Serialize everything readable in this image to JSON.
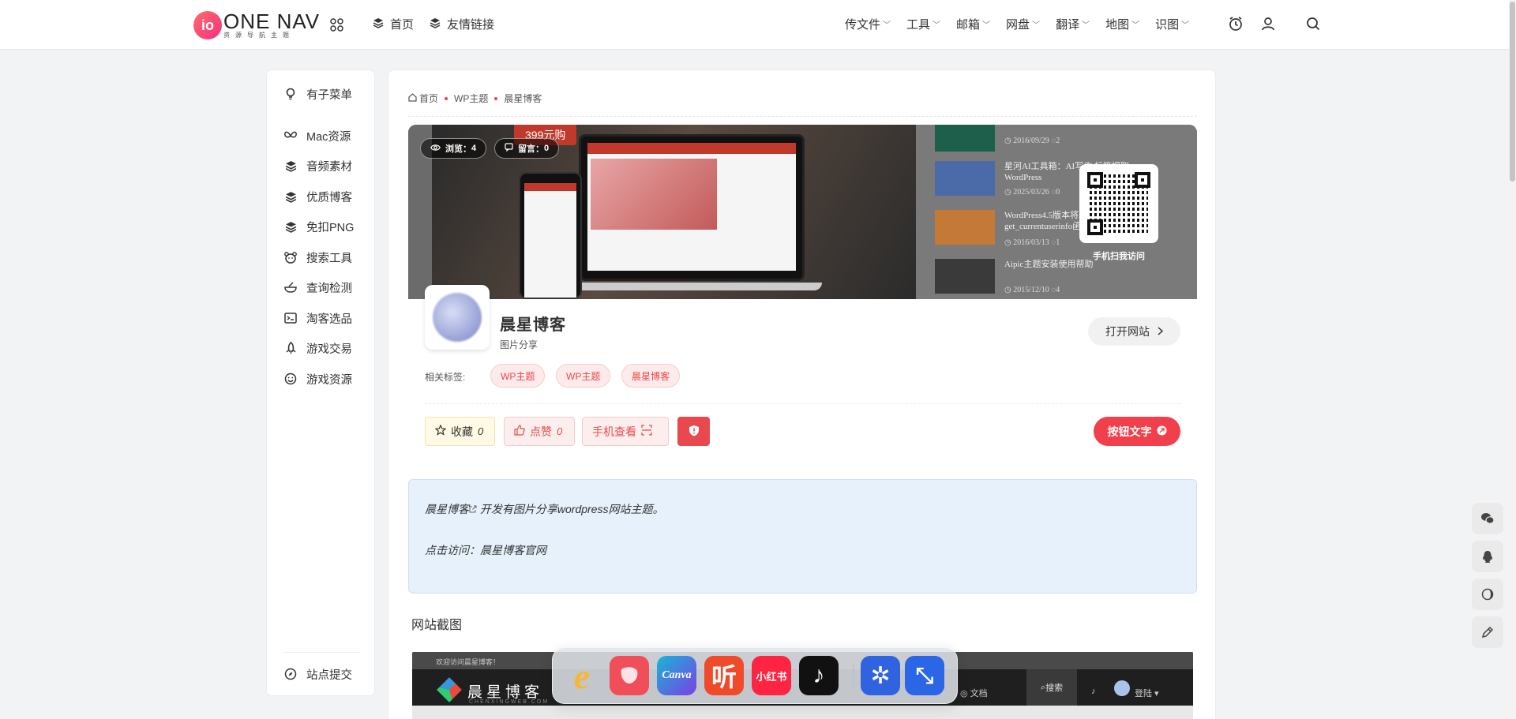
{
  "header": {
    "logo_mark": "io",
    "logo_name": "ONE NAV",
    "logo_tagline": "资源导航主题",
    "nav_left": [
      {
        "label": "首页",
        "icon": "layers-icon"
      },
      {
        "label": "友情链接",
        "icon": "layers-icon"
      }
    ],
    "nav_right": [
      {
        "label": "传文件"
      },
      {
        "label": "工具"
      },
      {
        "label": "邮箱"
      },
      {
        "label": "网盘"
      },
      {
        "label": "翻译"
      },
      {
        "label": "地图"
      },
      {
        "label": "识图"
      }
    ]
  },
  "sidebar": {
    "items": [
      {
        "label": "有子菜单",
        "icon": "bulb-icon"
      },
      {
        "label": "Mac资源",
        "icon": "butterfly-icon"
      },
      {
        "label": "音频素材",
        "icon": "layers-icon"
      },
      {
        "label": "优质博客",
        "icon": "layers-icon"
      },
      {
        "label": "免扣PNG",
        "icon": "layers-icon"
      },
      {
        "label": "搜索工具",
        "icon": "bear-icon"
      },
      {
        "label": "查询检测",
        "icon": "bowl-icon"
      },
      {
        "label": "淘客选品",
        "icon": "terminal-icon"
      },
      {
        "label": "游戏交易",
        "icon": "rocket-icon"
      },
      {
        "label": "游戏资源",
        "icon": "smile-icon"
      }
    ],
    "submit": {
      "label": "站点提交",
      "icon": "compass-icon"
    }
  },
  "breadcrumb": [
    "首页",
    "WP主题",
    "晨星博客"
  ],
  "banner": {
    "price": "399元购",
    "views_label": "浏览：",
    "views": "4",
    "comments_label": "留言：",
    "comments": "0",
    "qr_label": "手机扫我访问",
    "posts": [
      {
        "title": "",
        "date": "2016/09/29",
        "count": "2"
      },
      {
        "title": "星河AI工具箱：AI写作 标签提取，WordPress",
        "date": "2025/03/26",
        "count": "0"
      },
      {
        "title": "WordPress4.5版本将取 get_currentuserinfo函数",
        "date": "2016/03/13",
        "count": "1"
      },
      {
        "title": "Aipic主题安装使用帮助",
        "date": "2015/12/10",
        "count": "4"
      }
    ]
  },
  "site": {
    "title": "晨星博客",
    "subtitle": "图片分享",
    "open_label": "打开网站",
    "tags_label": "相关标签:",
    "tags": [
      "WP主题",
      "WP主题",
      "晨星博客"
    ]
  },
  "actions": {
    "collect_label": "收藏",
    "collect_count": "0",
    "like_label": "点赞",
    "like_count": "0",
    "mobile_label": "手机查看",
    "cta_label": "按钮文字"
  },
  "info": {
    "site_name": "晨星博客",
    "line1_rest": " 开发有图片分享wordpress网站主题。",
    "line2": "点击访问：晨星博客官网"
  },
  "section_title": "网站截图",
  "screenshot": {
    "welcome": "欢迎访问晨星博客！",
    "brand": "晨星博客",
    "brand_sub": "CHENXINGWEB.COM",
    "doc_label": "文档",
    "search_label": "搜索",
    "login_label": "登陆"
  },
  "dock": {
    "apps": [
      {
        "name": "ie-app-icon",
        "label": "e",
        "color": "#f7b733"
      },
      {
        "name": "red-app-icon",
        "label": "",
        "color": "#f04f5a"
      },
      {
        "name": "canva-app-icon",
        "label": "Canva",
        "color": "#18b6d8"
      },
      {
        "name": "ting-app-icon",
        "label": "听",
        "color": "#f04a2a"
      },
      {
        "name": "xiaohongshu-app-icon",
        "label": "小红书",
        "color": "#ff2442"
      },
      {
        "name": "tiktok-app-icon",
        "label": "♪",
        "color": "#111111"
      },
      {
        "name": "pinwheel-app-icon",
        "label": "✲",
        "color": "#2f63e0"
      },
      {
        "name": "shrink-app-icon",
        "label": "⤡",
        "color": "#2a66e6"
      }
    ]
  },
  "colors": {
    "accent": "#f1404b",
    "info_bg": "#e6f1fb"
  }
}
